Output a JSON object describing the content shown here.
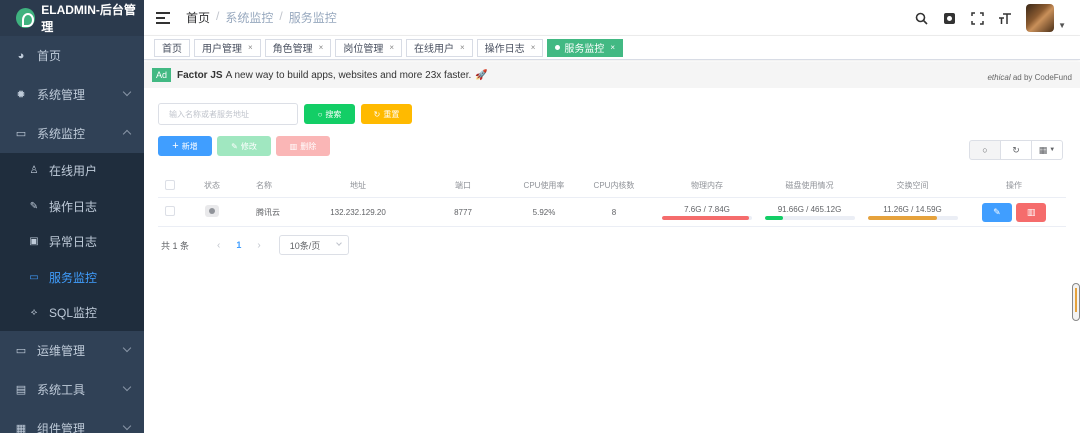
{
  "app": {
    "title": "ELADMIN-后台管理"
  },
  "sidebar": {
    "items": [
      {
        "label": "首页",
        "icon": "dashboard-icon"
      },
      {
        "label": "系统管理",
        "icon": "gear-icon"
      },
      {
        "label": "系统监控",
        "icon": "monitor-icon"
      },
      {
        "label": "运维管理",
        "icon": "ops-icon"
      },
      {
        "label": "系统工具",
        "icon": "toolbox-icon"
      },
      {
        "label": "组件管理",
        "icon": "grid-icon"
      }
    ],
    "submenu": [
      {
        "label": "在线用户",
        "icon": "user-icon"
      },
      {
        "label": "操作日志",
        "icon": "log-icon"
      },
      {
        "label": "异常日志",
        "icon": "error-log-icon"
      },
      {
        "label": "服务监控",
        "icon": "server-icon"
      },
      {
        "label": "SQL监控",
        "icon": "sql-icon"
      }
    ]
  },
  "breadcrumb": [
    "首页",
    "系统监控",
    "服务监控"
  ],
  "tags": [
    {
      "label": "首页"
    },
    {
      "label": "用户管理"
    },
    {
      "label": "角色管理"
    },
    {
      "label": "岗位管理"
    },
    {
      "label": "在线用户"
    },
    {
      "label": "操作日志"
    },
    {
      "label": "服务监控"
    }
  ],
  "ad": {
    "badge": "Ad",
    "title": "Factor JS",
    "text": "A new way to build apps, websites and more 23x faster.",
    "right_em": "ethical",
    "right_rest": "ad by CodeFund"
  },
  "toolbar": {
    "search_placeholder": "输入名称或者服务地址",
    "search_label": "搜索",
    "reset_label": "重置",
    "add_label": "新增",
    "edit_label": "修改",
    "delete_label": "删除"
  },
  "table": {
    "headers": {
      "status": "状态",
      "name": "名称",
      "address": "地址",
      "port": "端口",
      "cpu": "CPU使用率",
      "cores": "CPU内核数",
      "memory": "物理内存",
      "disk": "磁盘使用情况",
      "swap": "交换空间",
      "ops": "操作"
    },
    "row": {
      "name": "腾讯云",
      "address": "132.232.129.20",
      "port": "8777",
      "cpu": "5.92%",
      "cores": "8",
      "memory": "7.6G / 7.84G",
      "memory_pct": 97,
      "memory_color": "#f56c6c",
      "disk": "91.66G / 465.12G",
      "disk_pct": 20,
      "disk_color": "#13ce66",
      "swap": "11.26G / 14.59G",
      "swap_pct": 77,
      "swap_color": "#e6a23c"
    }
  },
  "pagination": {
    "total": "共 1 条",
    "page": "1",
    "size": "10条/页"
  }
}
